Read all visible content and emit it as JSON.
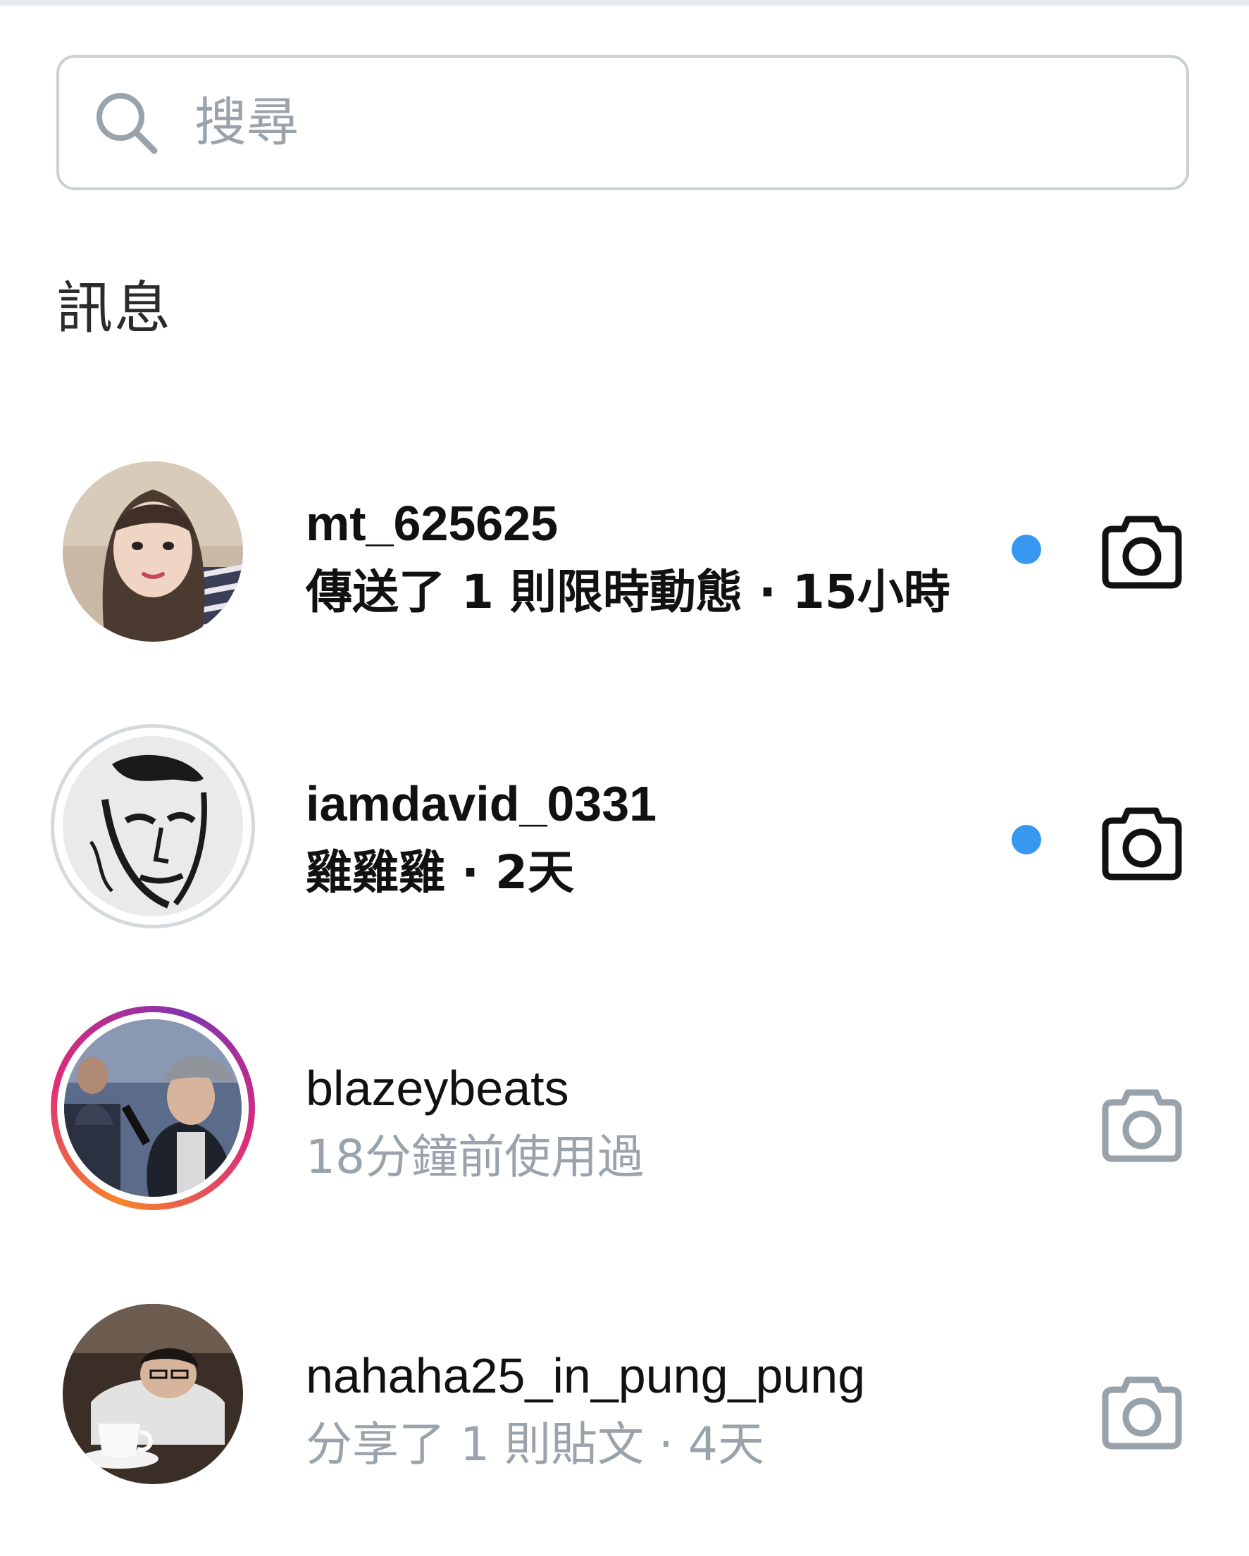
{
  "search": {
    "placeholder": "搜尋"
  },
  "section": {
    "title": "訊息"
  },
  "colors": {
    "unread_dot": "#3897f0",
    "camera_dark": "#111111",
    "camera_light": "#98a2aa",
    "muted_text": "#9aa3ab",
    "search_border": "#c9d0d6"
  },
  "conversations": [
    {
      "username": "mt_625625",
      "preview": "傳送了 1 則限時動態 · 15小時",
      "unread": true,
      "avatar_ring": "none",
      "camera_icon": "camera-icon"
    },
    {
      "username": "iamdavid_0331",
      "preview": "雞雞雞 · 2天",
      "unread": true,
      "avatar_ring": "gray",
      "camera_icon": "camera-icon"
    },
    {
      "username": "blazeybeats",
      "preview": "18分鐘前使用過",
      "unread": false,
      "avatar_ring": "story-gradient",
      "camera_icon": "camera-icon"
    },
    {
      "username": "nahaha25_in_pung_pung",
      "preview": "分享了 1 則貼文 · 4天",
      "unread": false,
      "avatar_ring": "none",
      "camera_icon": "camera-icon"
    }
  ]
}
